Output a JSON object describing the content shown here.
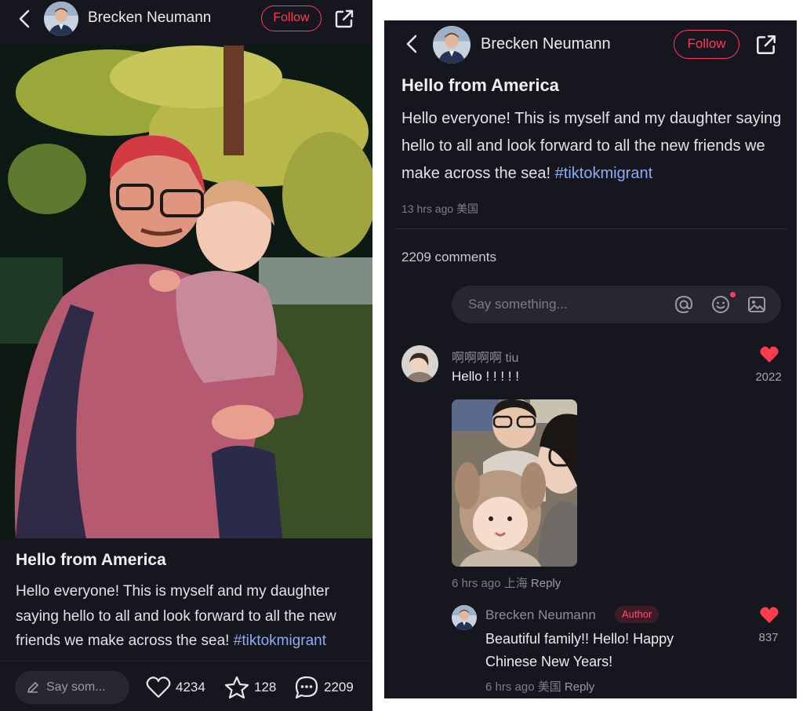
{
  "post": {
    "author": "Brecken Neumann",
    "follow_label": "Follow",
    "title": "Hello from America",
    "body": "Hello everyone! This is myself and my daughter saying hello to all and look forward to all the new friends we make across the sea!",
    "hashtag": "#tiktokmigrant",
    "time": "13 hrs ago",
    "location": "美国"
  },
  "left_bottom": {
    "say_placeholder": "Say som...",
    "likes": "4234",
    "favorites": "128",
    "comments": "2209"
  },
  "comments_section": {
    "count_label": "2209 comments",
    "input_placeholder": "Say something..."
  },
  "comment": {
    "user": "啊啊啊啊 tiu",
    "text": "Hello ! ! ! ! !",
    "likes": "2022",
    "time": "6 hrs ago",
    "location": "上海",
    "reply_label": "Reply"
  },
  "reply": {
    "user": "Brecken Neumann",
    "badge": "Author",
    "text": "Beautiful family!! Hello! Happy Chinese New Years!",
    "likes": "837",
    "time": "6 hrs ago",
    "location": "美国",
    "reply_label": "Reply"
  },
  "icons": {
    "back": "chevron-left-icon",
    "share": "share-external-icon",
    "like": "heart-icon",
    "favorite": "star-icon",
    "comment": "comment-bubble-icon",
    "mention": "at-icon",
    "emoji": "smiley-icon",
    "image": "image-icon",
    "edit": "pen-icon"
  },
  "colors": {
    "background": "#16161f",
    "accent": "#ff3b5c",
    "hashtag": "#8aaef0"
  }
}
